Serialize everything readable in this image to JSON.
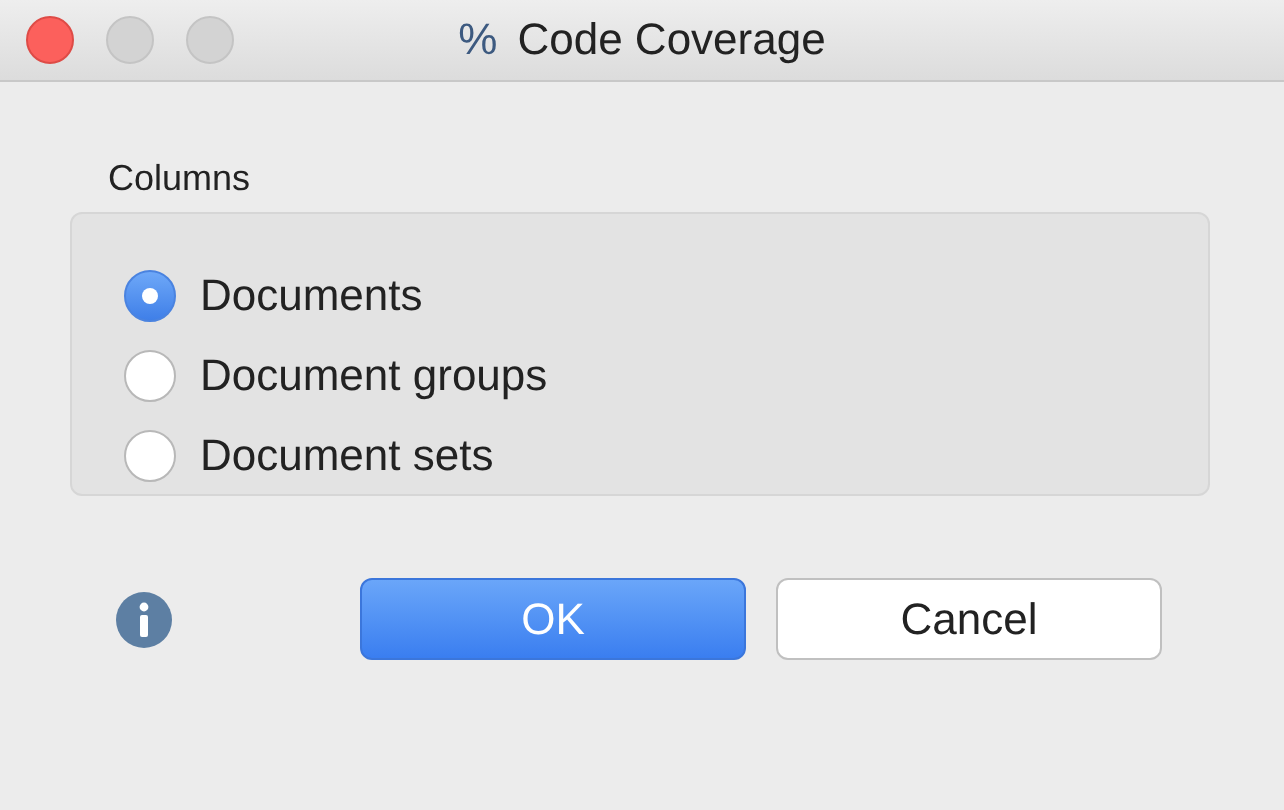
{
  "window": {
    "title_icon": "%",
    "title": "Code Coverage"
  },
  "group": {
    "label": "Columns",
    "options": [
      {
        "label": "Documents",
        "selected": true
      },
      {
        "label": "Document groups",
        "selected": false
      },
      {
        "label": "Document sets",
        "selected": false
      }
    ]
  },
  "buttons": [
    {
      "label": "OK",
      "kind": "default"
    },
    {
      "label": "Cancel",
      "kind": "normal"
    }
  ]
}
